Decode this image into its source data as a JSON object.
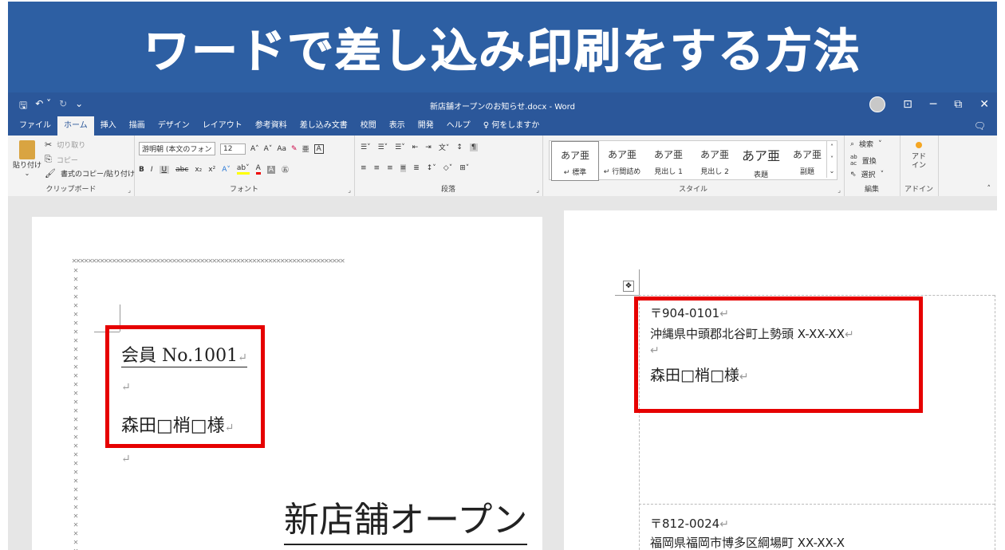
{
  "banner": {
    "title": "ワードで差し込み印刷をする方法"
  },
  "titlebar": {
    "document_title": "新店舗オープンのお知らせ.docx  -  Word",
    "qat": {
      "save_icon": "save-icon",
      "undo_icon": "undo-icon",
      "redo_icon": "redo-icon"
    },
    "minimize": "─",
    "restore": "⧉",
    "close": "✕",
    "ribbon_display": "⊡"
  },
  "tabs": [
    "ファイル",
    "ホーム",
    "挿入",
    "描画",
    "デザイン",
    "レイアウト",
    "参考資料",
    "差し込み文書",
    "校閲",
    "表示",
    "開発",
    "ヘルプ",
    "何をしますか"
  ],
  "active_tab": "ホーム",
  "ribbon": {
    "clipboard": {
      "label": "クリップボード",
      "paste": "貼り付け",
      "cut": "切り取り",
      "copy": "コピー",
      "format_painter": "書式のコピー/貼り付け"
    },
    "font": {
      "label": "フォント",
      "font_name": "游明朝 (本文のフォン",
      "font_size": "12",
      "bold": "B",
      "italic": "I",
      "underline": "U",
      "strike": "abc",
      "sub": "x₂",
      "sup": "x²",
      "grow": "A˄",
      "shrink": "A˅",
      "case": "Aa",
      "clear": "A",
      "color": "A"
    },
    "paragraph": {
      "label": "段落"
    },
    "styles": {
      "label": "スタイル",
      "items": [
        {
          "sample": "あア亜",
          "name": "↵ 標準"
        },
        {
          "sample": "あア亜",
          "name": "↵ 行間詰め"
        },
        {
          "sample": "あア亜",
          "name": "見出し 1"
        },
        {
          "sample": "あア亜",
          "name": "見出し 2"
        },
        {
          "sample": "あア亜",
          "name": "表題"
        },
        {
          "sample": "あア亜",
          "name": "副題"
        }
      ]
    },
    "editing": {
      "label": "編集",
      "find": "検索",
      "replace": "置換",
      "select": "選択"
    },
    "addin": {
      "label": "アドイン",
      "button": "アド\nイン"
    }
  },
  "left_page": {
    "member": "会員 No.1001",
    "name": "森田□梢□様",
    "heading": "新店舗オープン",
    "return_mark": "↵"
  },
  "right_page": {
    "label1": {
      "postal": "〒904-0101",
      "address": "沖縄県中頭郡北谷町上勢頭 X-XX-XX",
      "name": "森田□梢□様"
    },
    "label2": {
      "postal": "〒812-0024",
      "address": "福岡県福岡市博多区綱場町 XX-XX-X"
    },
    "return_mark": "↵"
  },
  "colors": {
    "accent": "#2b579a",
    "banner": "#2d5fa3",
    "highlight": "#e60000"
  }
}
